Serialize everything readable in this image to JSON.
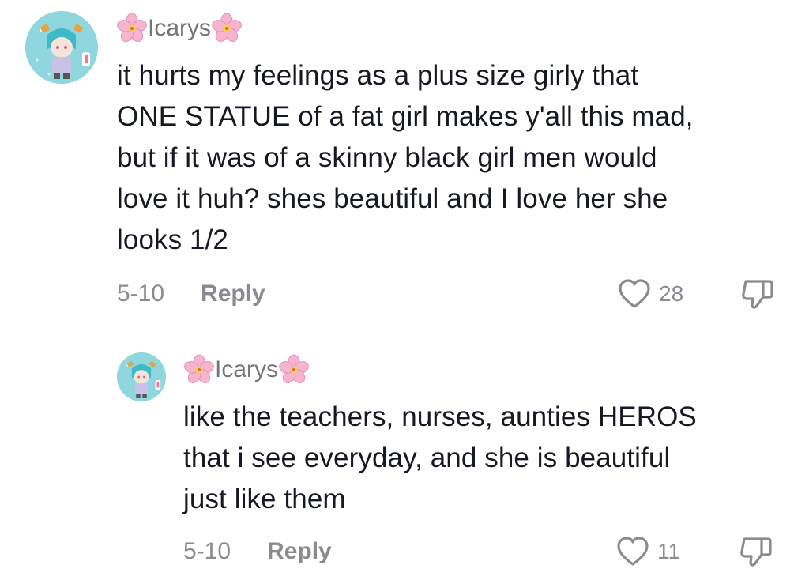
{
  "comments": [
    {
      "username": "Icarys",
      "text_lines": [
        "it hurts my feelings as a plus size girly that",
        "ONE STATUE of a fat girl makes y'all this mad,",
        "but if it was of a skinny black girl men would",
        "love it huh? shes beautiful and I love her she",
        "looks 1/2"
      ],
      "date": "5-10",
      "reply_label": "Reply",
      "like_count": "28"
    },
    {
      "username": "Icarys",
      "text_lines": [
        "like the teachers, nurses, aunties HEROS",
        "that i see everyday, and she is beautiful",
        "just like them"
      ],
      "date": "5-10",
      "reply_label": "Reply",
      "like_count": "11"
    }
  ],
  "icons": {
    "flower": "cherry-blossom-icon",
    "like": "heart-icon",
    "dislike": "thumbs-down-icon"
  },
  "colors": {
    "text": "#161823",
    "muted": "#8a8b91",
    "username": "#757575",
    "flower_pink": "#f7a8c8",
    "avatar_teal": "#6cc7d2"
  }
}
